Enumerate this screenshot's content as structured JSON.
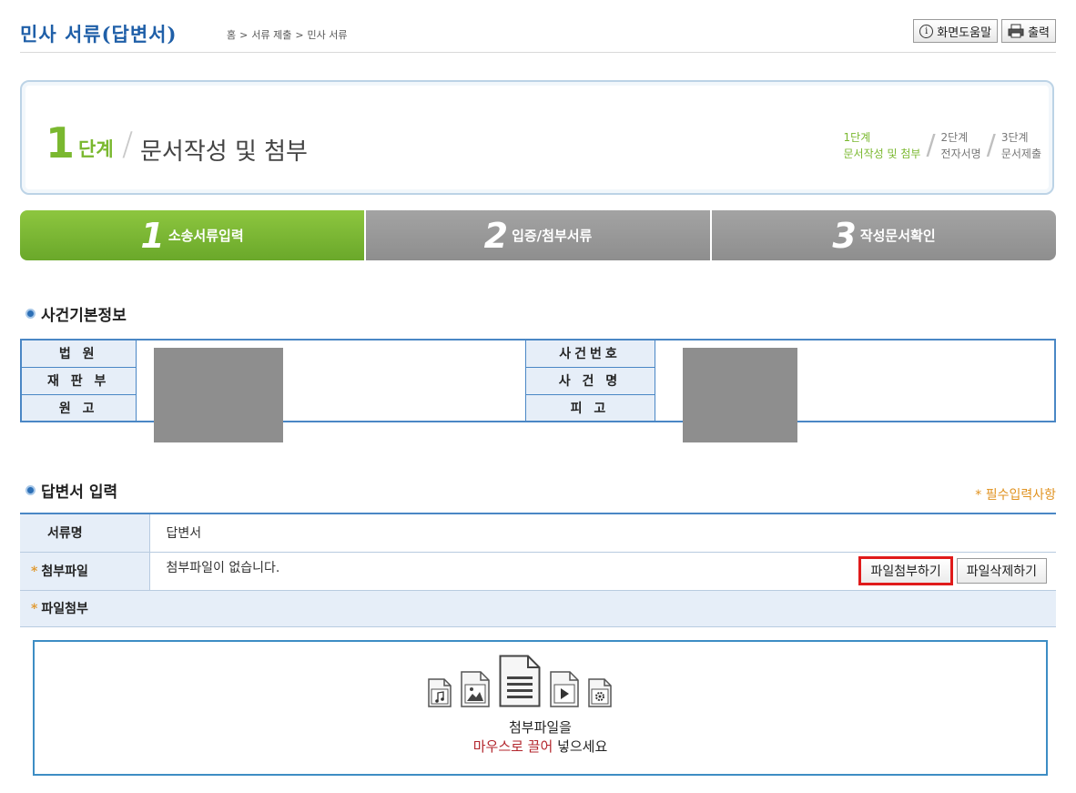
{
  "header": {
    "title": "민사 서류(답변서)",
    "breadcrumb": [
      "홈",
      "서류 제출",
      "민사 서류"
    ],
    "help_button": "화면도움말",
    "print_button": "출력"
  },
  "stepbox": {
    "number": "1",
    "word": "단계",
    "title": "문서작성 및 첨부",
    "mini_steps": [
      {
        "line1": "1단계",
        "line2": "문서작성 및 첨부"
      },
      {
        "line1": "2단계",
        "line2": "전자서명"
      },
      {
        "line1": "3단계",
        "line2": "문서제출"
      }
    ]
  },
  "tabs": [
    {
      "num": "1",
      "label": "소송서류입력"
    },
    {
      "num": "2",
      "label": "입증/첨부서류"
    },
    {
      "num": "3",
      "label": "작성문서확인"
    }
  ],
  "case_info": {
    "section_title": "사건기본정보",
    "court_label": "법 원",
    "division_label": "재 판 부",
    "plaintiff_label": "원 고",
    "case_no_label": "사건번호",
    "case_name_label": "사 건 명",
    "defendant_label": "피 고"
  },
  "answer": {
    "section_title": "답변서 입력",
    "required_note": "* 필수입력사항",
    "doc_name_label": "서류명",
    "doc_name_value": "답변서",
    "attach_label": "첨부파일",
    "attach_value": "첨부파일이 없습니다.",
    "attach_button": "파일첨부하기",
    "delete_button": "파일삭제하기",
    "upload_label": "파일첨부"
  },
  "dropzone": {
    "line1": "첨부파일을",
    "line2_red": "마우스로 끌어",
    "line2_rest": " 넣으세요",
    "icons": [
      "audio-file-icon",
      "image-file-icon",
      "document-file-icon",
      "video-file-icon",
      "settings-file-icon"
    ]
  },
  "colors": {
    "accent_green": "#7ab82f",
    "accent_blue": "#4a87c5",
    "highlight_red": "#e01b1b"
  }
}
